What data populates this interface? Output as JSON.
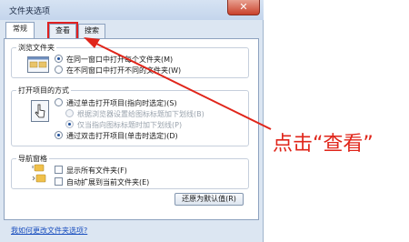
{
  "window": {
    "title": "文件夹选项",
    "close_symbol": "✕"
  },
  "tabs": [
    {
      "label": "常规"
    },
    {
      "label": "查看"
    },
    {
      "label": "搜索"
    }
  ],
  "browse_group": {
    "title": "浏览文件夹",
    "options": [
      {
        "label": "在同一窗口中打开每个文件夹(M)",
        "checked": true
      },
      {
        "label": "在不同窗口中打开不同的文件夹(W)",
        "checked": false
      }
    ]
  },
  "click_group": {
    "title": "打开项目的方式",
    "options": [
      {
        "label": "通过单击打开项目(指向时选定)(S)",
        "checked": false
      },
      {
        "label": "根据浏览器设置给图标标题加下划线(B)",
        "checked": false,
        "disabled": true
      },
      {
        "label": "仅当指向图标标题时加下划线(P)",
        "checked": true,
        "disabled": true
      },
      {
        "label": "通过双击打开项目(单击时选定)(D)",
        "checked": true
      }
    ]
  },
  "nav_group": {
    "title": "导航窗格",
    "options": [
      {
        "label": "显示所有文件夹(F)"
      },
      {
        "label": "自动扩展到当前文件夹(E)"
      }
    ]
  },
  "restore_button": "还原为默认值(R)",
  "help_link": "我如何更改文件夹选项?",
  "annotation": "点击“查看”",
  "colors": {
    "annotation": "#e0251a",
    "accent": "#1d4f9a"
  },
  "icons": [
    "close-icon",
    "folder-window-icon",
    "cursor-hand-icon",
    "folder-icon"
  ]
}
